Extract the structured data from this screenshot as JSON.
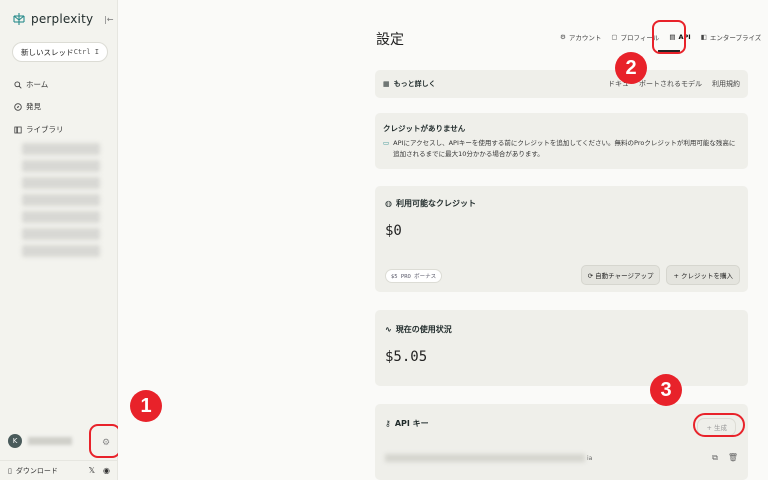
{
  "sidebar": {
    "brand": "perplexity",
    "new_thread": "新しいスレッド",
    "new_thread_kbd": "Ctrl I",
    "nav": [
      {
        "label": "ホーム",
        "icon": "search-icon"
      },
      {
        "label": "発見",
        "icon": "compass-icon"
      },
      {
        "label": "ライブラリ",
        "icon": "library-icon"
      }
    ],
    "avatar": "K",
    "download": "ダウンロード"
  },
  "header": {
    "title": "設定",
    "tabs": [
      {
        "label": "アカウント",
        "icon": "gear-icon"
      },
      {
        "label": "プロフィール",
        "icon": "profile-icon"
      },
      {
        "label": "API",
        "icon": "api-icon",
        "active": true
      },
      {
        "label": "エンタープライズ",
        "icon": "enterprise-icon"
      }
    ]
  },
  "learn_more": {
    "label": "もっと詳しく",
    "links": [
      "ドキュ",
      "ポートされるモデル",
      "利用規約"
    ]
  },
  "no_credit": {
    "title": "クレジットがありません",
    "message": "APIにアクセスし、APIキーを使用する前にクレジットを追加してください。無料のProクレジットが利用可能な残高に追加されるまでに最大10分かかる場合があります。"
  },
  "credits": {
    "title": "利用可能なクレジット",
    "amount": "$0",
    "bonus": "$5 PRO ボーナス",
    "auto_charge": "自動チャージアップ",
    "buy": "クレジットを購入"
  },
  "usage": {
    "title": "現在の使用状況",
    "amount": "$5.05"
  },
  "api_keys": {
    "title": "API キー",
    "generate": "+ 生成",
    "key_suffix": "ia"
  },
  "markers": [
    "1",
    "2",
    "3"
  ],
  "colors": {
    "annotation": "#e8222a",
    "sidebar_bg": "#f3f3ee",
    "card_bg": "#efefea"
  }
}
